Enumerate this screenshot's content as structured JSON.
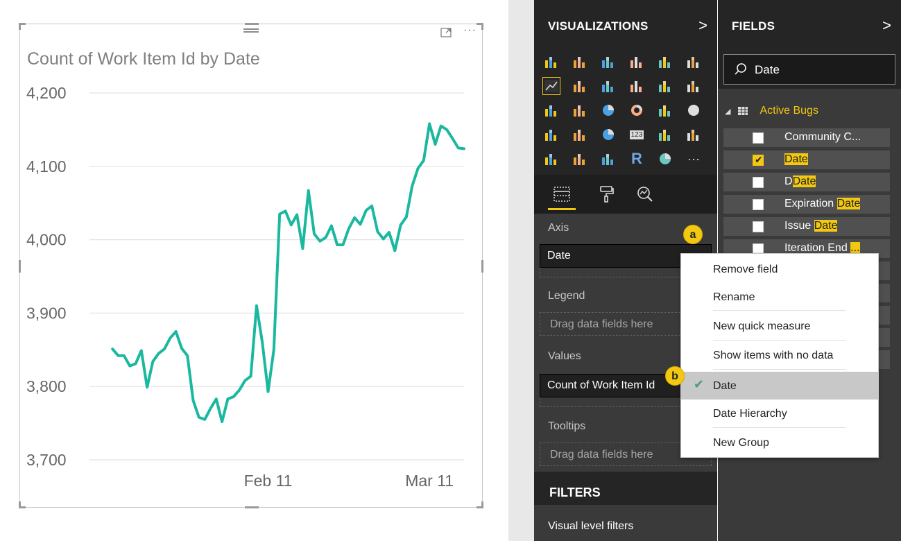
{
  "chart": {
    "title": "Count of Work Item Id by Date",
    "line_color": "#1bb8a0",
    "gridline_color": "#e3e3e3"
  },
  "chart_data": {
    "type": "line",
    "title": "Count of Work Item Id by Date",
    "xlabel": "",
    "ylabel": "",
    "ylim": [
      3700,
      4200
    ],
    "yticks": [
      "4,200",
      "4,100",
      "4,000",
      "3,900",
      "3,800",
      "3,700"
    ],
    "yticks_values": [
      4200,
      4100,
      4000,
      3900,
      3800,
      3700
    ],
    "xlim": [
      "2017-01-11",
      "2017-03-17"
    ],
    "xticks": [
      "Feb 11",
      "Mar 11"
    ],
    "xticks_dates": [
      "2017-02-11",
      "2017-03-11"
    ],
    "grid": true,
    "series": [
      {
        "color": "#1bb8a0",
        "x": [
          "2017-01-15",
          "2017-01-16",
          "2017-01-17",
          "2017-01-18",
          "2017-01-19",
          "2017-01-20",
          "2017-01-21",
          "2017-01-22",
          "2017-01-23",
          "2017-01-24",
          "2017-01-25",
          "2017-01-26",
          "2017-01-27",
          "2017-01-28",
          "2017-01-29",
          "2017-01-30",
          "2017-01-31",
          "2017-02-01",
          "2017-02-02",
          "2017-02-03",
          "2017-02-04",
          "2017-02-05",
          "2017-02-06",
          "2017-02-07",
          "2017-02-08",
          "2017-02-09",
          "2017-02-10",
          "2017-02-11",
          "2017-02-12",
          "2017-02-13",
          "2017-02-14",
          "2017-02-15",
          "2017-02-16",
          "2017-02-17",
          "2017-02-18",
          "2017-02-19",
          "2017-02-20",
          "2017-02-21",
          "2017-02-22",
          "2017-02-23",
          "2017-02-24",
          "2017-02-25",
          "2017-02-26",
          "2017-02-27",
          "2017-02-28",
          "2017-03-01",
          "2017-03-02",
          "2017-03-03",
          "2017-03-04",
          "2017-03-05",
          "2017-03-06",
          "2017-03-07",
          "2017-03-08",
          "2017-03-09",
          "2017-03-10",
          "2017-03-11",
          "2017-03-12",
          "2017-03-13",
          "2017-03-14",
          "2017-03-15",
          "2017-03-16",
          "2017-03-17"
        ],
        "values": [
          3851,
          3842,
          3842,
          3828,
          3831,
          3849,
          3799,
          3834,
          3845,
          3851,
          3866,
          3875,
          3852,
          3842,
          3781,
          3758,
          3755,
          3770,
          3783,
          3752,
          3783,
          3786,
          3795,
          3808,
          3814,
          3910,
          3860,
          3793,
          3850,
          4035,
          4039,
          4020,
          4034,
          3988,
          4067,
          4008,
          3998,
          4003,
          4019,
          3993,
          3993,
          4015,
          4030,
          4021,
          4040,
          4046,
          4011,
          4001,
          4010,
          3985,
          4020,
          4031,
          4073,
          4097,
          4108,
          4158,
          4130,
          4155,
          4150,
          4138,
          4125,
          4124
        ]
      }
    ]
  },
  "viz_pane": {
    "title": "VISUALIZATIONS",
    "chevron": ">",
    "icons": [
      "stacked-bar-icon",
      "stacked-column-icon",
      "clustered-bar-icon",
      "clustered-column-icon",
      "100-stacked-bar-icon",
      "100-stacked-column-icon",
      "line-chart-icon",
      "area-chart-icon",
      "stacked-area-icon",
      "line-clustered-column-icon",
      "line-stacked-column-icon",
      "ribbon-chart-icon",
      "waterfall-icon",
      "scatter-icon",
      "pie-icon",
      "donut-icon",
      "treemap-icon",
      "map-icon",
      "filled-map-icon",
      "funnel-icon",
      "gauge-icon",
      "card-icon",
      "multirow-card-icon",
      "kpi-icon",
      "slicer-icon",
      "table-icon",
      "matrix-icon",
      "r-visual-icon",
      "globe-icon",
      "more-icon"
    ],
    "r_glyph": "R",
    "card_glyph": "123",
    "more_glyph": "···",
    "axis_label": "Axis",
    "axis_field": "Date",
    "legend_label": "Legend",
    "legend_placeholder": "Drag data fields here",
    "values_label": "Values",
    "values_field": "Count of Work Item Id",
    "tooltips_label": "Tooltips",
    "tooltips_placeholder": "Drag data fields here",
    "filters_title": "FILTERS",
    "visual_filters": "Visual level filters"
  },
  "fields_pane": {
    "title": "FIELDS",
    "chevron": ">",
    "search_value": "Date",
    "table_name": "Active Bugs",
    "expand_glyph": "◢",
    "fields": [
      {
        "pre": "Community C...",
        "hl": "",
        "post": "",
        "checked": false
      },
      {
        "pre": "",
        "hl": "Date",
        "post": "",
        "checked": true
      },
      {
        "pre": "D",
        "hl": "Date",
        "post": "",
        "checked": false
      },
      {
        "pre": "Expiration ",
        "hl": "Date",
        "post": "",
        "checked": false
      },
      {
        "pre": "Issue ",
        "hl": "Date",
        "post": "",
        "checked": false
      },
      {
        "pre": "Iteration End ",
        "hl": "...",
        "post": "",
        "checked": false
      }
    ]
  },
  "context_menu": {
    "items": [
      "Remove field",
      "Rename",
      "New quick measure",
      "Show items with no data",
      "Date",
      "Date Hierarchy",
      "New Group"
    ],
    "active_index": 4,
    "check_glyph": "✔"
  },
  "callouts": {
    "a": "a",
    "b": "b"
  },
  "visual_header": {
    "more_glyph": "···"
  },
  "colors": {
    "accent_yellow": "#f2c811",
    "pane_dark": "#252526",
    "pane_mid": "#3a3a3a",
    "line_teal": "#1bb8a0"
  }
}
